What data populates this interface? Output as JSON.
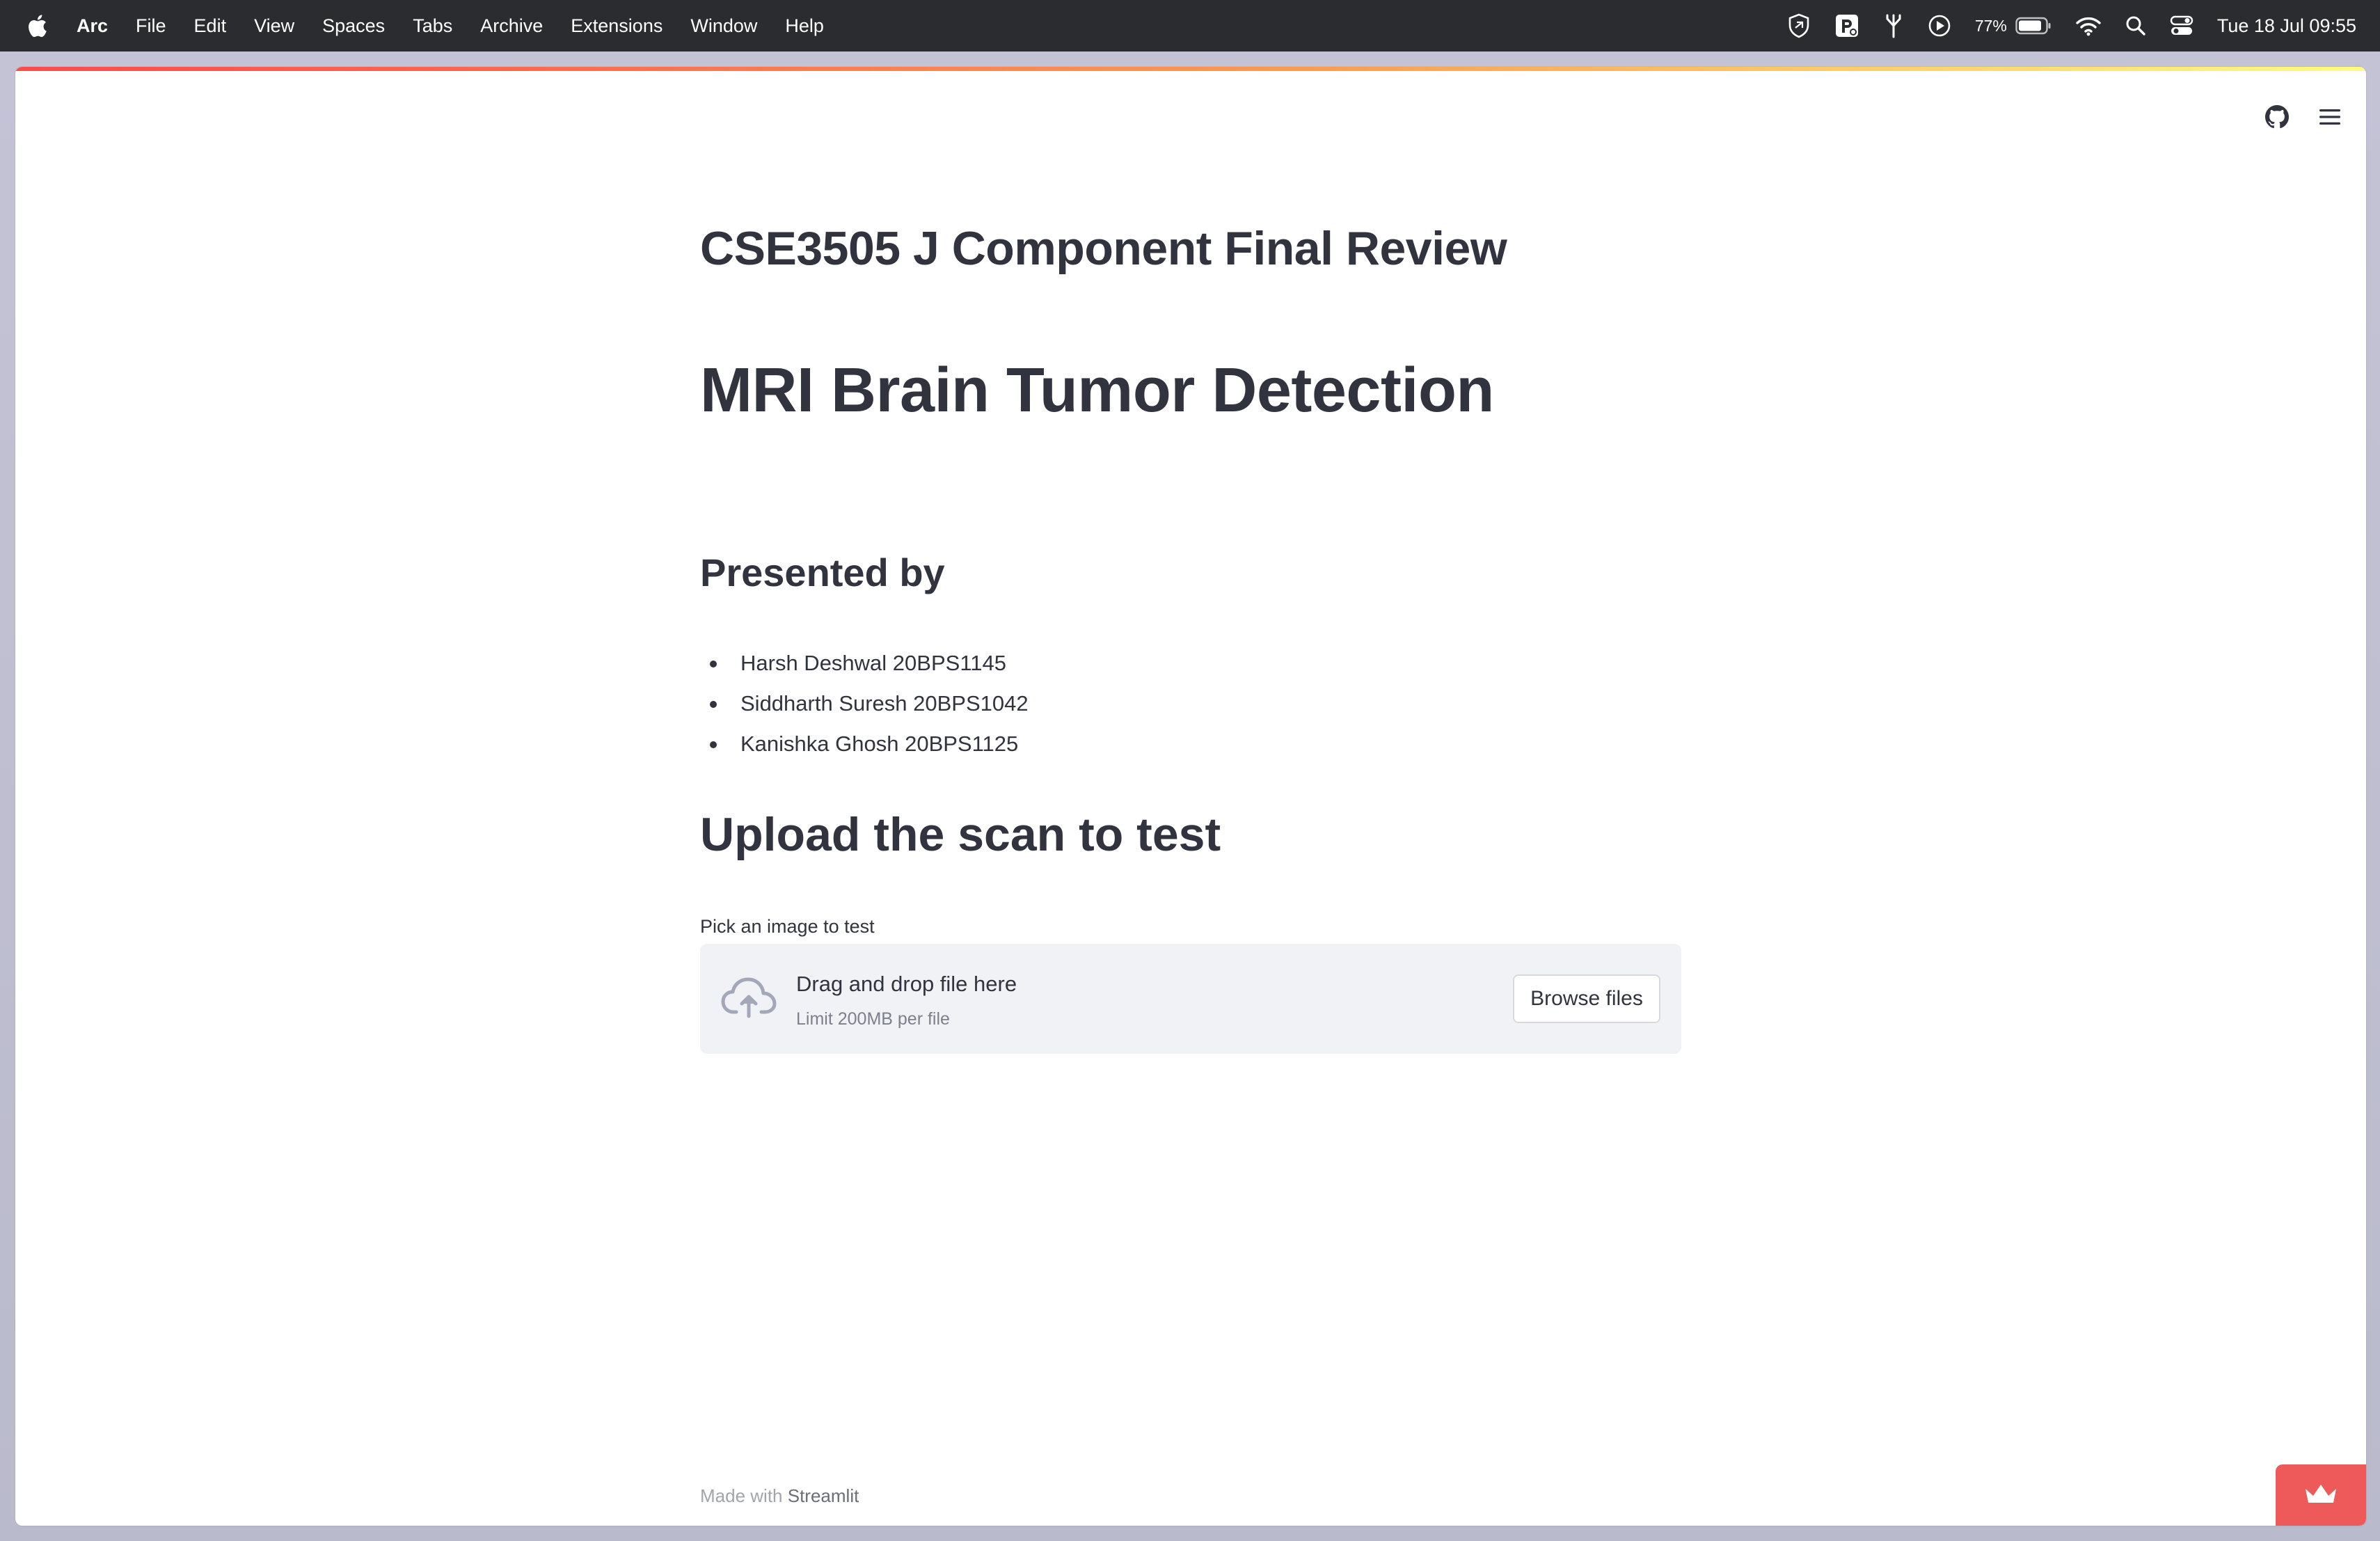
{
  "menubar": {
    "app_name": "Arc",
    "items": [
      "File",
      "Edit",
      "View",
      "Spaces",
      "Tabs",
      "Archive",
      "Extensions",
      "Window",
      "Help"
    ],
    "battery_percent": "77%",
    "clock": "Tue 18 Jul  09:55"
  },
  "page": {
    "title": "CSE3505 J Component Final Review",
    "heading": "MRI Brain Tumor Detection",
    "presented_by_heading": "Presented by",
    "presenters": [
      "Harsh Deshwal 20BPS1145",
      "Siddharth Suresh 20BPS1042",
      "Kanishka Ghosh 20BPS1125"
    ],
    "upload_heading": "Upload the scan to test",
    "uploader": {
      "label": "Pick an image to test",
      "drop_text": "Drag and drop file here",
      "limit_text": "Limit 200MB per file",
      "browse_label": "Browse files"
    },
    "footer": {
      "prefix": "Made with",
      "brand": "Streamlit"
    }
  },
  "colors": {
    "menubar_bg": "#2a2c30",
    "text": "#31333f",
    "dropzone_bg": "#f0f2f6",
    "accent_red": "#ff4b4b",
    "deploy_badge": "#ee5a5a"
  },
  "icons": {
    "apple": "apple-logo-icon",
    "github": "github-icon",
    "menu": "hamburger-menu-icon",
    "upload": "cloud-upload-icon",
    "deploy": "crown-icon"
  }
}
